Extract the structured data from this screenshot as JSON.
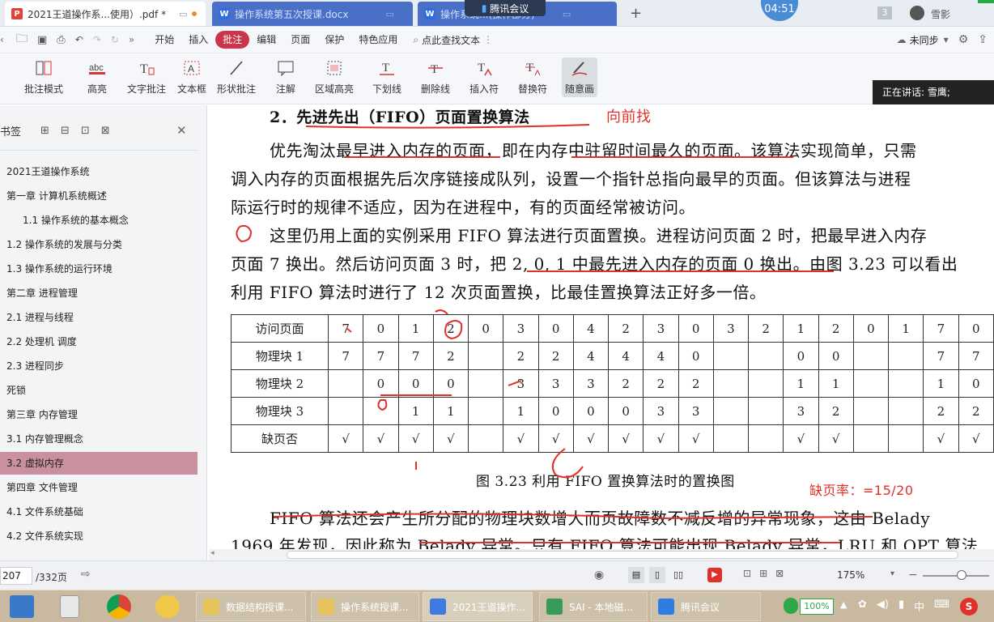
{
  "tabs": [
    {
      "label": "2021王道操作系...使用）.pdf *",
      "type": "pdf",
      "active": true
    },
    {
      "label": "操作系统第五次授课.docx",
      "type": "doc",
      "active": false
    },
    {
      "label": "操作系统...(操作部分)",
      "type": "doc",
      "active": false
    }
  ],
  "meeting_overlay": {
    "label": "腾讯会议",
    "timer": "04:51"
  },
  "tab_badge": "3",
  "user_name": "雪影",
  "menu": [
    "开始",
    "插入",
    "批注",
    "编辑",
    "页面",
    "保护",
    "特色应用"
  ],
  "active_menu": "批注",
  "search_placeholder": "点此查找文本",
  "sync_label": "未同步",
  "ribbon": [
    "批注模式",
    "高亮",
    "文字批注",
    "文本框",
    "形状批注",
    "注解",
    "区域高亮",
    "下划线",
    "删除线",
    "插入符",
    "替换符",
    "随意画"
  ],
  "speaking_label": "正在讲话: 雪鹰;",
  "sidebar": {
    "title": "书签",
    "items": [
      "2021王道操作系统",
      "第一章 计算机系统概述",
      "1.1 操作系统的基本概念",
      "1.2 操作系统的发展与分类",
      "1.3 操作系统的运行环境",
      "第二章  进程管理",
      "2.1 进程与线程",
      "2.2 处理机 调度",
      "2.3 进程同步",
      "死锁",
      "第三章 内存管理",
      "3.1 内存管理概念",
      "3.2 虚拟内存",
      "第四章 文件管理",
      "4.1 文件系统基础",
      "4.2 文件系统实现"
    ],
    "selected_index": 12
  },
  "doc": {
    "heading": "2．先进先出（FIFO）页面置换算法",
    "annot_heading": "向前找",
    "para1": [
      "优先淘汰最早进入内存的页面，即在内存中驻留时间最久的页面。该算法实现简单，只需",
      "调入内存的页面根据先后次序链接成队列，设置一个指针总指向最早的页面。但该算法与进程",
      "际运行时的规律不适应，因为在进程中，有的页面经常被访问。"
    ],
    "para2": [
      "这里仍用上面的实例采用 FIFO 算法进行页面置换。进程访问页面 2 时，把最早进入内存",
      "页面 7 换出。然后访问页面 3 时，把 2, 0, 1 中最先进入内存的页面 0 换出。由图 3.23 可以看出",
      "利用 FIFO 算法时进行了 12 次页面置换，比最佳置换算法正好多一倍。"
    ],
    "table": {
      "rows": [
        {
          "h": "访问页面",
          "c": [
            "7",
            "0",
            "1",
            "2",
            "0",
            "3",
            "0",
            "4",
            "2",
            "3",
            "0",
            "3",
            "2",
            "1",
            "2",
            "0",
            "1",
            "7",
            "0"
          ]
        },
        {
          "h": "物理块 1",
          "c": [
            "7",
            "7",
            "7",
            "2",
            "",
            "2",
            "2",
            "4",
            "4",
            "4",
            "0",
            "",
            "",
            "0",
            "0",
            "",
            "",
            "7",
            "7"
          ]
        },
        {
          "h": "物理块 2",
          "c": [
            "",
            "0",
            "0",
            "0",
            "",
            "3",
            "3",
            "3",
            "2",
            "2",
            "2",
            "",
            "",
            "1",
            "1",
            "",
            "",
            "1",
            "0"
          ]
        },
        {
          "h": "物理块 3",
          "c": [
            "",
            "",
            "1",
            "1",
            "",
            "1",
            "0",
            "0",
            "0",
            "3",
            "3",
            "",
            "",
            "3",
            "2",
            "",
            "",
            "2",
            "2"
          ]
        },
        {
          "h": "缺页否",
          "c": [
            "√",
            "√",
            "√",
            "√",
            "",
            "√",
            "√",
            "√",
            "√",
            "√",
            "√",
            "",
            "",
            "√",
            "√",
            "",
            "",
            "√",
            "√"
          ]
        }
      ]
    },
    "caption": "图 3.23    利用 FIFO 置换算法时的置换图",
    "annot_rate": "缺页率：=15/20",
    "para3": [
      "FIFO 算法还会产生所分配的物理块数增大而页故障数不减反增的异常现象，这由 Belady",
      "1969 年发现，因此称为 Belady 异常。只有 FIFO 算法可能出现 Belady 异常，LRU 和 OPT 算法"
    ]
  },
  "status": {
    "page": "207",
    "total": "/332页",
    "zoom": "175%"
  },
  "taskbar": {
    "items": [
      "数据结构授课...",
      "操作系统授课...",
      "2021王道操作...",
      "SAI - 本地磁...",
      "腾讯会议"
    ],
    "active_index": 2,
    "battery": "100%",
    "ime": "中"
  },
  "colors": {
    "accent": "#c9364b",
    "annot_red": "#e0302a",
    "selected_sidebar": "#c9909f"
  }
}
